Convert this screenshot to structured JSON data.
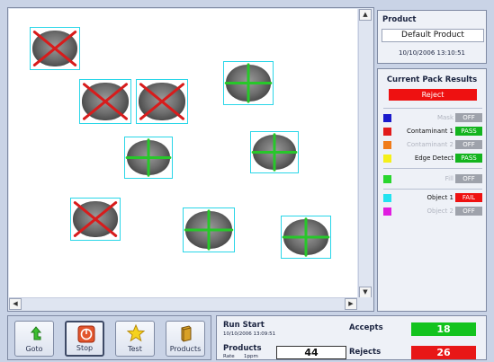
{
  "colors": {
    "pass": "#13b41e",
    "fail": "#ee1111",
    "off": "#9ea2ab",
    "accepts": "#13c31e",
    "rejects": "#e81717"
  },
  "product": {
    "title": "Product",
    "name": "Default Product",
    "date": "10/10/2006 13:10:51"
  },
  "pack": {
    "title": "Current Pack Results",
    "result": "Reject",
    "rows": [
      {
        "label": "Mask",
        "status": "OFF",
        "color": "#1a1acc",
        "dim": true
      },
      {
        "label": "Contaminant 1",
        "status": "PASS",
        "color": "#e21b1b",
        "dim": false
      },
      {
        "label": "Contaminant 2",
        "status": "OFF",
        "color": "#f07c1a",
        "dim": true
      },
      {
        "label": "Edge Detect",
        "status": "PASS",
        "color": "#f5f019",
        "dim": false
      },
      {
        "label": "Fill",
        "status": "OFF",
        "color": "#29d62e",
        "dim": true
      },
      {
        "label": "Object 1",
        "status": "FAIL",
        "color": "#23e3f0",
        "dim": false
      },
      {
        "label": "Object 2",
        "status": "OFF",
        "color": "#e01de0",
        "dim": true
      }
    ]
  },
  "blobs": [
    {
      "state": "reject"
    },
    {
      "state": "reject"
    },
    {
      "state": "reject"
    },
    {
      "state": "accept"
    },
    {
      "state": "accept"
    },
    {
      "state": "accept"
    },
    {
      "state": "reject"
    },
    {
      "state": "accept"
    },
    {
      "state": "accept"
    }
  ],
  "toolbar": {
    "goto": "Goto",
    "stop": "Stop",
    "test": "Test",
    "products": "Products"
  },
  "status": {
    "run_start_label": "Run Start",
    "run_start_time": "10/10/2006 13:09:51",
    "products_label": "Products",
    "rate_label": "Rate",
    "rate_value": "1ppm",
    "products_count": "44",
    "accepts_label": "Accepts",
    "accepts_count": "18",
    "rejects_label": "Rejects",
    "rejects_count": "26"
  },
  "icons": {
    "goto": "green-arrow-icon",
    "stop": "stop-icon",
    "test": "star-icon",
    "products": "products-icon"
  }
}
